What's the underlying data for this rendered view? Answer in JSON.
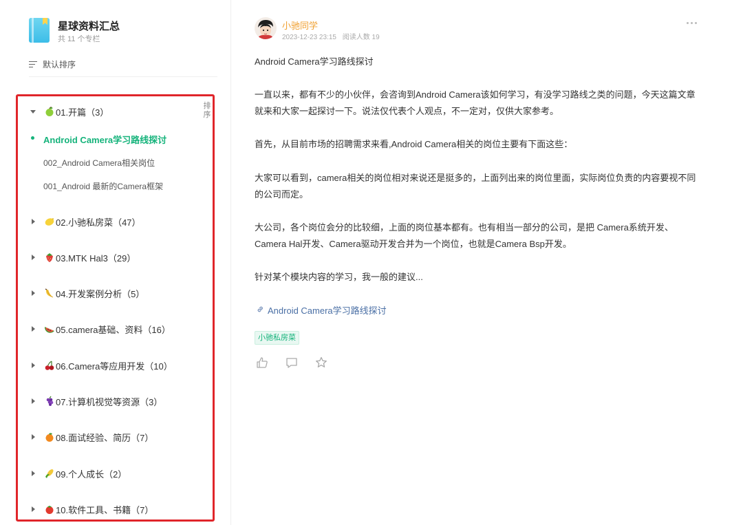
{
  "column": {
    "title": "星球资料汇总",
    "count": "共 11 个专栏",
    "sort_label": "默认排序"
  },
  "toc": {
    "sort_label": "排序",
    "chapters": [
      {
        "label": "01.开篇（3）",
        "fruit": "green-apple",
        "color": "#8fcf3a",
        "expanded": true
      },
      {
        "label": "02.小驰私房菜（47）",
        "fruit": "lemon",
        "color": "#f7d33a"
      },
      {
        "label": "03.MTK Hal3（29）",
        "fruit": "strawberry",
        "color": "#e0403a"
      },
      {
        "label": "04.开发案例分析（5）",
        "fruit": "banana",
        "color": "#f2c53a"
      },
      {
        "label": "05.camera基础、资料（16）",
        "fruit": "watermelon",
        "color": "#e9533e"
      },
      {
        "label": "06.Camera等应用开发（10）",
        "fruit": "cherries",
        "color": "#c9202a"
      },
      {
        "label": "07.计算机视觉等资源（3）",
        "fruit": "grapes",
        "color": "#7a3ab0"
      },
      {
        "label": "08.面试经验、简历（7）",
        "fruit": "tangerine",
        "color": "#f28a1f"
      },
      {
        "label": "09.个人成长（2）",
        "fruit": "corn",
        "color": "#f2c93a"
      },
      {
        "label": "10.软件工具、书籍（7）",
        "fruit": "tomato",
        "color": "#e23a2e"
      }
    ],
    "articles": [
      {
        "label": "Android Camera学习路线探讨",
        "active": true
      },
      {
        "label": "002_Android Camera相关岗位",
        "active": false
      },
      {
        "label": "001_Android 最新的Camera框架",
        "active": false
      }
    ]
  },
  "post": {
    "author": "小驰同学",
    "date": "2023-12-23 23:15",
    "read_count": "阅读人数 19",
    "paragraphs": [
      "Android Camera学习路线探讨",
      "一直以来，都有不少的小伙伴，会咨询到Android Camera该如何学习，有没学习路线之类的问题，今天这篇文章就来和大家一起探讨一下。说法仅代表个人观点，不一定对，仅供大家参考。",
      "首先，从目前市场的招聘需求来看,Android Camera相关的岗位主要有下面这些：",
      "大家可以看到，camera相关的岗位相对来说还是挺多的，上面列出来的岗位里面，实际岗位负责的内容要视不同的公司而定。",
      "大公司，各个岗位会分的比较细，上面的岗位基本都有。也有相当一部分的公司，是把 Camera系统开发、Camera Hal开发、Camera驱动开发合并为一个岗位，也就是Camera Bsp开发。",
      "针对某个模块内容的学习，我一般的建议..."
    ],
    "link_text": "Android Camera学习路线探讨",
    "tag": "小驰私房菜"
  },
  "colors": {
    "accent_green": "#15b37b",
    "highlight_red": "#e0252a",
    "author_orange": "#f0a030",
    "link_blue": "#4a6fa5"
  }
}
